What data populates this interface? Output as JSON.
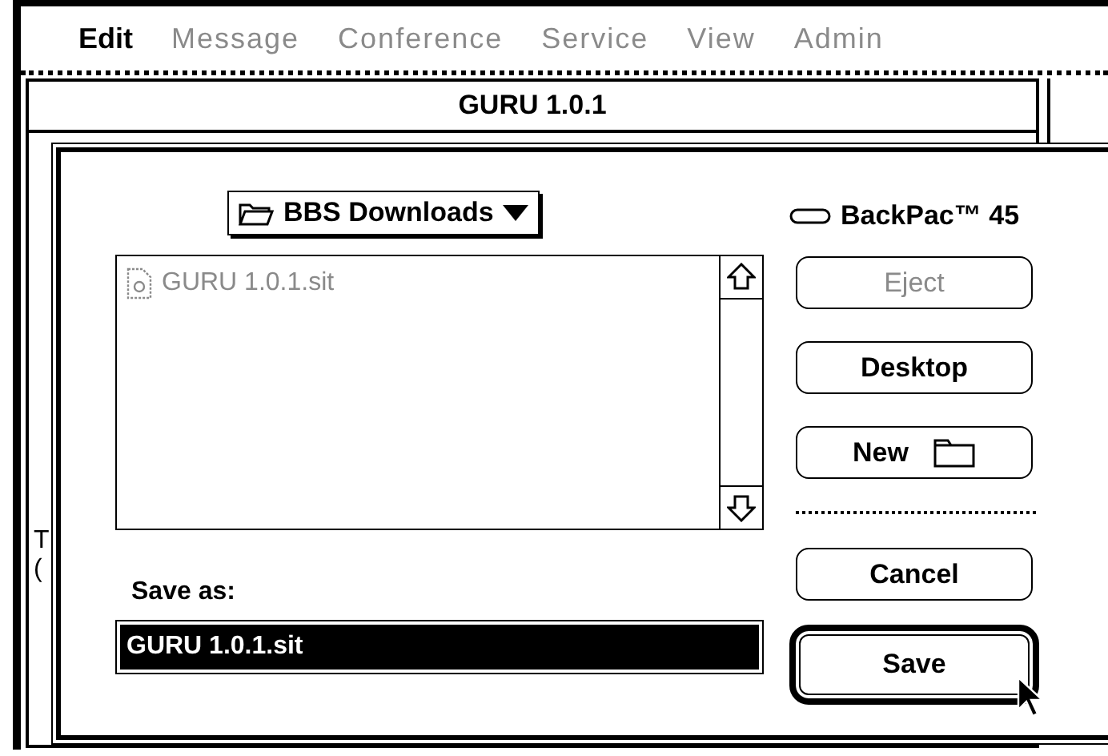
{
  "menu_bar": {
    "items": [
      {
        "label": "Edit",
        "disabled": false
      },
      {
        "label": "Message",
        "disabled": true
      },
      {
        "label": "Conference",
        "disabled": true
      },
      {
        "label": "Service",
        "disabled": true
      },
      {
        "label": "View",
        "disabled": true
      },
      {
        "label": "Admin",
        "disabled": true
      }
    ]
  },
  "background_window": {
    "title": "GURU 1.0.1",
    "text_fragments": [
      "T",
      "("
    ]
  },
  "dialog": {
    "folder_popup": {
      "label": "BBS Downloads"
    },
    "disk": {
      "label": "BackPac™ 45"
    },
    "files": [
      {
        "name": "GURU 1.0.1.sit",
        "disabled": true,
        "selected": false
      }
    ],
    "buttons": [
      {
        "label": "Eject",
        "kind": "plain",
        "disabled": true
      },
      {
        "label": "Desktop",
        "kind": "plain",
        "disabled": false
      },
      {
        "label": "New",
        "kind": "new-folder",
        "disabled": false
      }
    ],
    "save_as": {
      "label": "Save as:",
      "value": "GURU 1.0.1.sit",
      "selected": true
    },
    "action_buttons": [
      {
        "label": "Cancel",
        "default": false,
        "disabled": false
      },
      {
        "label": "Save",
        "default": true,
        "disabled": false
      }
    ]
  }
}
